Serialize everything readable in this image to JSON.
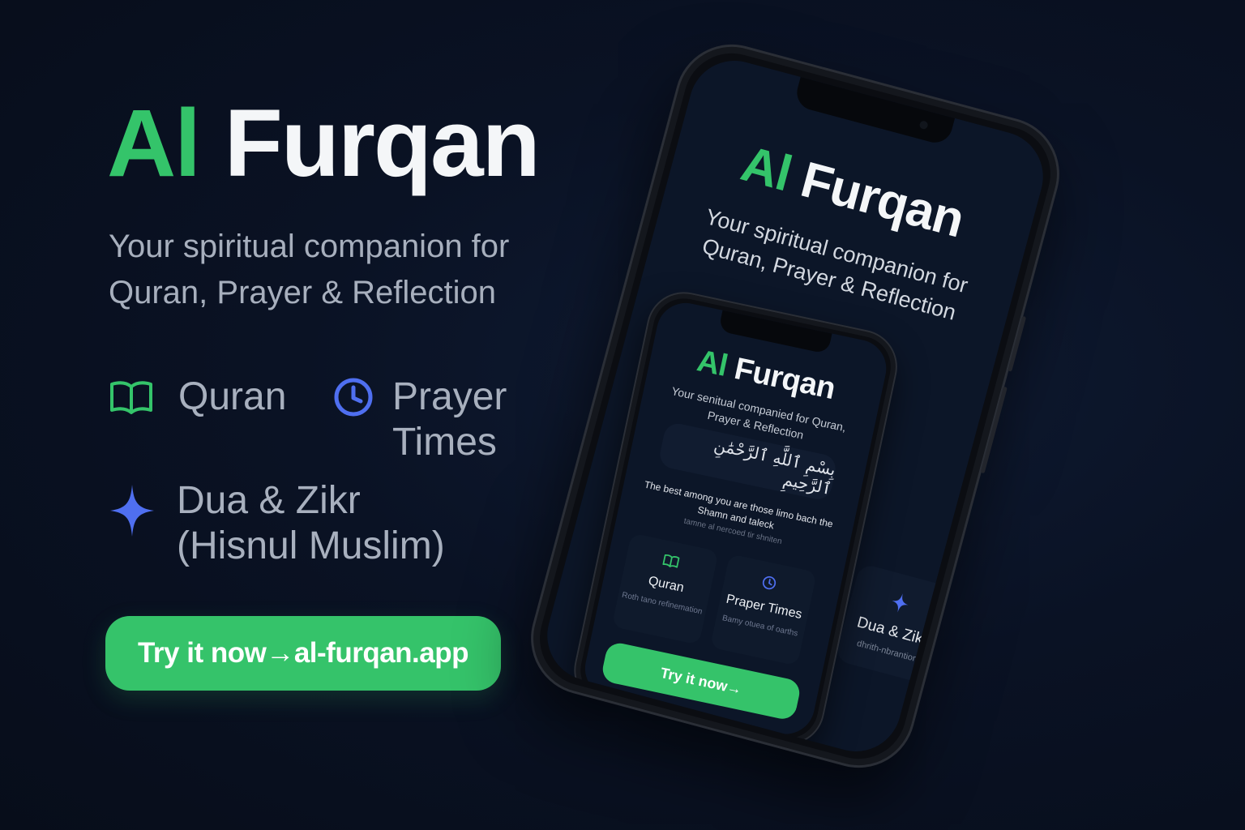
{
  "brand": {
    "accent": "Al",
    "main": "Furqan"
  },
  "tagline": "Your spiritual companion for Quran, Prayer & Reflection",
  "features": [
    {
      "label": "Quran",
      "icon": "book-icon",
      "color": "#34c46a"
    },
    {
      "label": "Prayer Times",
      "icon": "clock-icon",
      "color": "#4f6ff0"
    },
    {
      "label": "Dua & Zikr (Hisnul Muslim)",
      "icon": "sparkle-icon",
      "color": "#4f6ff0"
    }
  ],
  "cta": {
    "label": "Try it now→al-furqan.app"
  },
  "colors": {
    "accent_green": "#35c36a",
    "accent_blue": "#4f6ff0",
    "background": "#0a1224"
  },
  "mockup": {
    "outer": {
      "title_accent": "Al",
      "title_main": "Furqan",
      "tagline": "Your spiritual companion for Quran, Prayer & Reflection",
      "side_card_title": "Dua & Zikr",
      "side_card_sub": "dhrith-nbrantion"
    },
    "inner": {
      "title_accent": "Al",
      "title_main": "Furqan",
      "tagline": "Your senitual companied for Quran, Prayer & Reflection",
      "arabic": "بِسْمِ ٱللَّهِ ٱلرَّحْمَٰنِ ٱلرَّحِيمِ",
      "quote": "The best among you are those limo bach the Shamn and taleck",
      "quote_faint": "tamne al nercoed tir shniten",
      "cards": [
        {
          "title": "Quran",
          "sub": "Roth tano refinemation"
        },
        {
          "title": "Praper Times",
          "sub": "Bamy otuea of oarths"
        }
      ],
      "cta": "Try it now→"
    }
  }
}
